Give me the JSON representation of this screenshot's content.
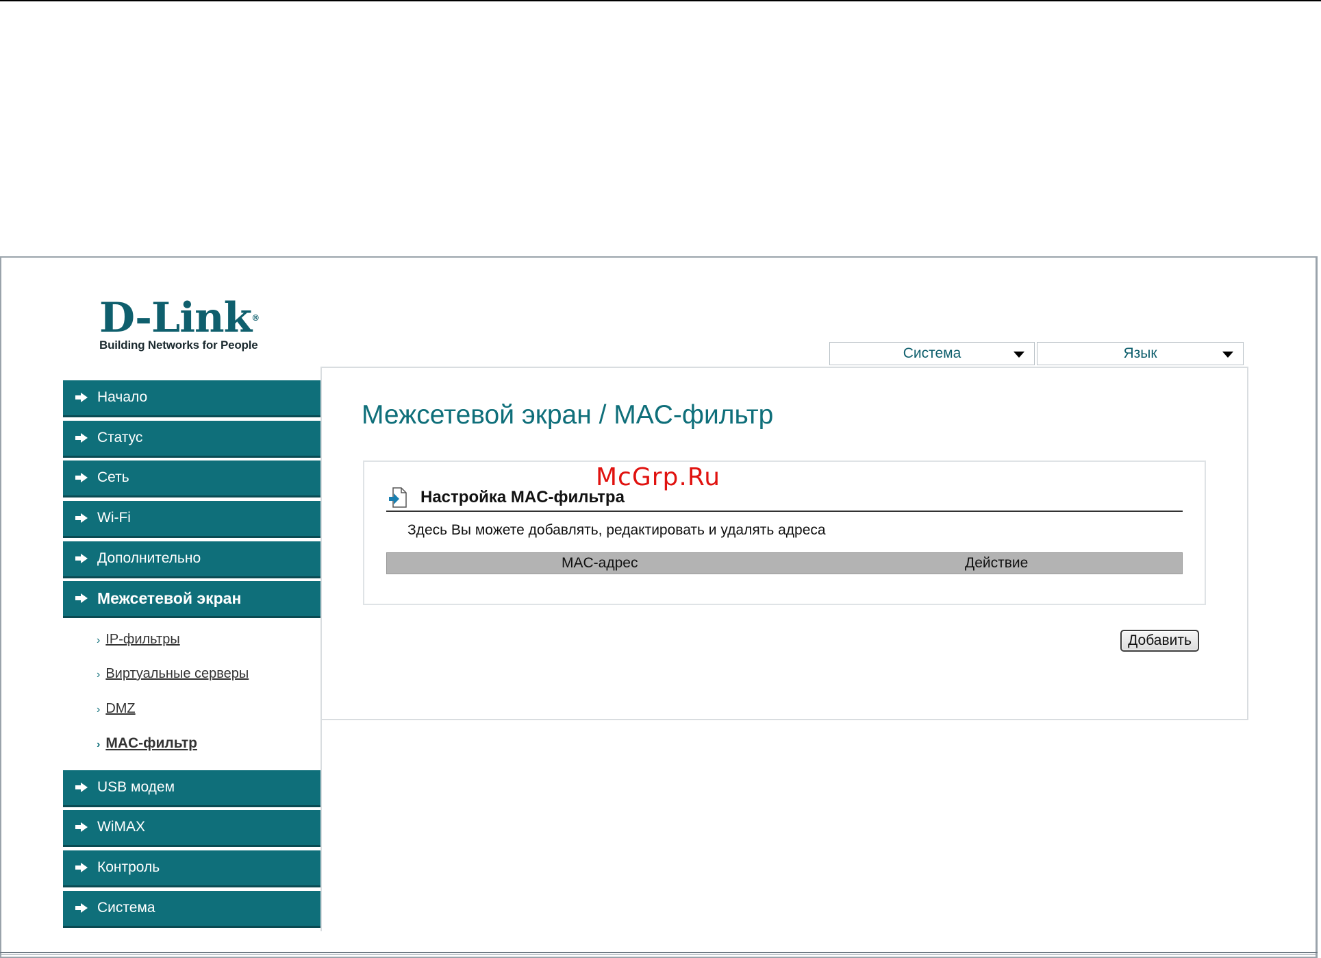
{
  "logo": {
    "wordmark": "D-Link",
    "trademark": "®",
    "tagline": "Building Networks for People"
  },
  "top_menu": {
    "system_label": "Система",
    "language_label": "Язык"
  },
  "sidebar": {
    "items": [
      {
        "label": "Начало"
      },
      {
        "label": "Статус"
      },
      {
        "label": "Сеть"
      },
      {
        "label": "Wi-Fi"
      },
      {
        "label": "Дополнительно"
      },
      {
        "label": "Межсетевой экран"
      },
      {
        "label": "USB модем"
      },
      {
        "label": "WiMAX"
      },
      {
        "label": "Контроль"
      },
      {
        "label": "Система"
      }
    ],
    "active_index": 5,
    "submenu": [
      {
        "label": "IP-фильтры"
      },
      {
        "label": "Виртуальные серверы"
      },
      {
        "label": "DMZ"
      },
      {
        "label": "MAC-фильтр"
      }
    ]
  },
  "main": {
    "page_title": "Межсетевой экран  / MAC-фильтр",
    "section_title": "Настройка MAC-фильтра",
    "section_description": "Здесь Вы можете добавлять, редактировать и удалять адреса",
    "table_headers": [
      "MAC-адрес",
      "Действие"
    ],
    "add_button_label": "Добавить"
  },
  "watermark": "McGrp.Ru",
  "colors": {
    "accent": "#0f6f7a",
    "accent_dark": "#0a4a52",
    "table_header_bg": "#b3b3b3"
  }
}
